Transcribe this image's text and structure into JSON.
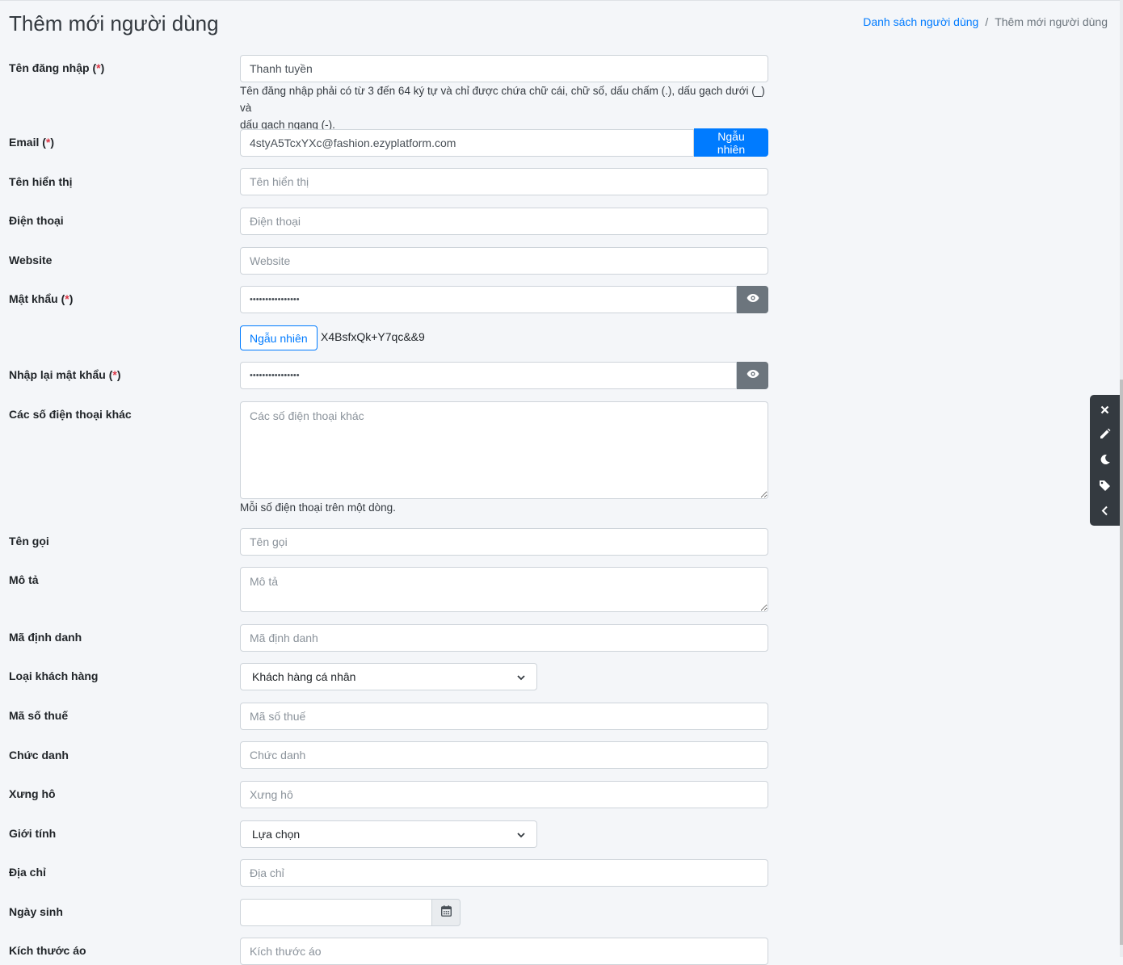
{
  "page": {
    "title": "Thêm mới người dùng",
    "breadcrumb": {
      "parent": "Danh sách người dùng",
      "separator": "/",
      "current": "Thêm mới người dùng"
    }
  },
  "form": {
    "username": {
      "label": "Tên đăng nhập (",
      "req": "*",
      "label_end": ")",
      "value": "Thanh tuyền",
      "help_line1": "Tên đăng nhập phải có từ 3 đến 64 ký tự và chỉ được chứa chữ cái, chữ số, dấu chấm (.), dấu gạch dưới (_) và",
      "help_line2": "dấu gạch ngang (-)."
    },
    "email": {
      "label": "Email (",
      "req": "*",
      "label_end": ")",
      "value": "4styA5TcxYXc@fashion.ezyplatform.com",
      "random_button": "Ngẫu nhiên"
    },
    "display_name": {
      "label": "Tên hiển thị",
      "placeholder": "Tên hiển thị"
    },
    "phone": {
      "label": "Điện thoại",
      "placeholder": "Điện thoại"
    },
    "website": {
      "label": "Website",
      "placeholder": "Website"
    },
    "password": {
      "label": "Mật khẩu (",
      "req": "*",
      "label_end": ")",
      "value": "••••••••••••••••",
      "random_button": "Ngẫu nhiên",
      "generated": "X4BsfxQk+Y7qc&&9"
    },
    "confirm_password": {
      "label": "Nhập lại mật khẩu (",
      "req": "*",
      "label_end": ")",
      "value": "••••••••••••••••"
    },
    "other_phones": {
      "label": "Các số điện thoại khác",
      "placeholder": "Các số điện thoại khác",
      "help": "Mỗi số điện thoại trên một dòng."
    },
    "nickname": {
      "label": "Tên gọi",
      "placeholder": "Tên gọi"
    },
    "description": {
      "label": "Mô tả",
      "placeholder": "Mô tả"
    },
    "identifier": {
      "label": "Mã định danh",
      "placeholder": "Mã định danh"
    },
    "customer_type": {
      "label": "Loại khách hàng",
      "selected": "Khách hàng cá nhân"
    },
    "tax_code": {
      "label": "Mã số thuế",
      "placeholder": "Mã số thuế"
    },
    "job_title": {
      "label": "Chức danh",
      "placeholder": "Chức danh"
    },
    "salutation": {
      "label": "Xưng hô",
      "placeholder": "Xưng hô"
    },
    "gender": {
      "label": "Giới tính",
      "selected": "Lựa chọn"
    },
    "address": {
      "label": "Địa chỉ",
      "placeholder": "Địa chỉ"
    },
    "birthday": {
      "label": "Ngày sinh",
      "value": ""
    },
    "shirt_size": {
      "label": "Kích thước áo",
      "placeholder": "Kích thước áo"
    }
  },
  "icons": {
    "eye": "eye-icon",
    "calendar": "calendar-icon",
    "close": "close-icon",
    "pencil": "pencil-icon",
    "moon": "moon-icon",
    "tag": "tag-icon",
    "chevron": "chevron-left-icon"
  },
  "colors": {
    "primary": "#007bff",
    "required": "#dc3545",
    "secondary": "#6c757d",
    "toolbar": "#343a40"
  }
}
